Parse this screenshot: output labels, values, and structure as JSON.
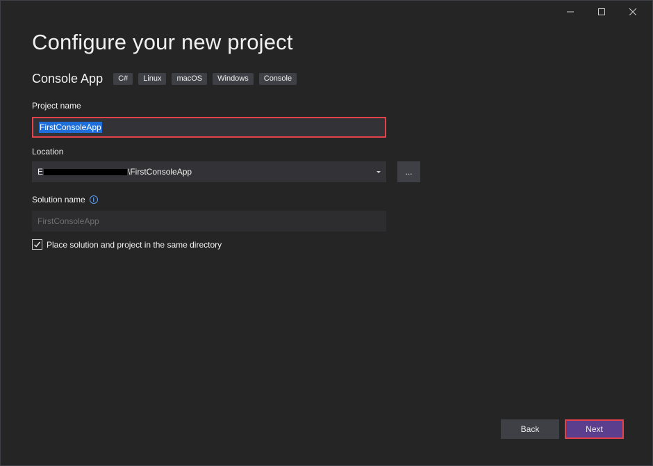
{
  "window_controls": {
    "minimize_icon": "minimize-icon",
    "maximize_icon": "maximize-icon",
    "close_icon": "close-icon"
  },
  "header": {
    "title": "Configure your new project",
    "template_name": "Console App",
    "tags": [
      "C#",
      "Linux",
      "macOS",
      "Windows",
      "Console"
    ]
  },
  "form": {
    "project_name_label": "Project name",
    "project_name_value": "FirstConsoleApp",
    "location_label": "Location",
    "location_value_prefix": "E",
    "location_value_suffix": "\\FirstConsoleApp",
    "browse_label": "...",
    "solution_name_label": "Solution name",
    "solution_name_placeholder": "FirstConsoleApp",
    "same_directory_label": "Place solution and project in the same directory",
    "same_directory_checked": true
  },
  "footer": {
    "back_label": "Back",
    "next_label": "Next"
  },
  "colors": {
    "background": "#252526",
    "accent": "#5b3e8e",
    "highlight_border": "#e3424a",
    "selection": "#1e6fd9"
  }
}
